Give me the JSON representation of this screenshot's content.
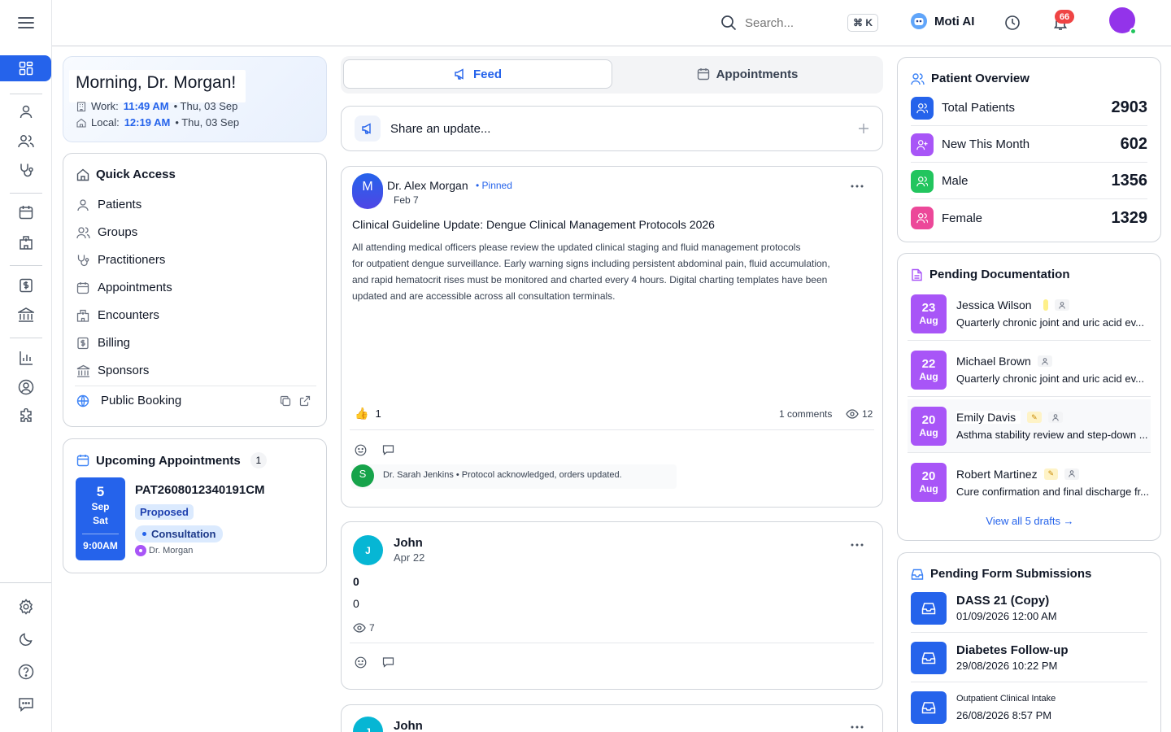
{
  "header": {
    "search_placeholder": "Search...",
    "shortcut": "⌘ K",
    "ai_label": "Moti AI",
    "notification_count": "66"
  },
  "greeting": {
    "title": "Morning, Dr. Morgan!",
    "work_label": "Work:",
    "work_time": "11:49 AM",
    "work_date": "• Thu, 03 Sep",
    "local_label": "Local:",
    "local_time": "12:19 AM",
    "local_date": "• Thu, 03 Sep"
  },
  "quick_access": {
    "title": "Quick Access",
    "items": [
      {
        "label": "Patients",
        "icon": "user-icon"
      },
      {
        "label": "Groups",
        "icon": "users-icon"
      },
      {
        "label": "Practitioners",
        "icon": "stethoscope-icon"
      },
      {
        "label": "Appointments",
        "icon": "calendar-icon"
      },
      {
        "label": "Encounters",
        "icon": "hospital-icon"
      },
      {
        "label": "Billing",
        "icon": "billing-icon"
      },
      {
        "label": "Sponsors",
        "icon": "bank-icon"
      }
    ],
    "public_booking": "Public Booking"
  },
  "upcoming": {
    "title": "Upcoming Appointments",
    "count": "1",
    "appointment": {
      "day": "5",
      "month": "Sep",
      "weekday": "Sat",
      "time": "9:00AM",
      "id": "PAT2608012340191CM",
      "status": "Proposed",
      "type": "Consultation",
      "practitioner": "Dr. Morgan"
    }
  },
  "tabs": {
    "feed": "Feed",
    "appointments": "Appointments"
  },
  "share": {
    "placeholder": "Share an update..."
  },
  "posts": [
    {
      "avatar": "M",
      "author": "Dr. Alex Morgan",
      "pinned": "• Pinned",
      "date": "Feb 7",
      "title": "Clinical Guideline Update: Dengue Clinical Management Protocols 2026",
      "body_lines": [
        "All attending medical officers please review the updated clinical staging and fluid management protocols",
        "for outpatient dengue surveillance. Early warning signs including persistent abdominal pain, fluid accumulation,",
        "and rapid hematocrit rises must be monitored and charted every 4 hours. Digital charting templates have been",
        "updated and are accessible across all consultation terminals."
      ],
      "likes": "1",
      "comments": "1 comments",
      "views": "12",
      "comment": {
        "avatar": "S",
        "text": "Dr. Sarah Jenkins • Protocol acknowledged, orders updated."
      }
    },
    {
      "avatar": "J",
      "author": "John",
      "date": "Apr 22",
      "title": "0",
      "body": "0",
      "views": "7"
    },
    {
      "avatar": "J",
      "author": "John"
    }
  ],
  "patient_overview": {
    "title": "Patient Overview",
    "rows": [
      {
        "label": "Total Patients",
        "value": "2903",
        "color": "#2563eb"
      },
      {
        "label": "New This Month",
        "value": "602",
        "color": "#a855f7"
      },
      {
        "label": "Male",
        "value": "1356",
        "color": "#22c55e"
      },
      {
        "label": "Female",
        "value": "1329",
        "color": "#ec4899"
      }
    ]
  },
  "pending_docs": {
    "title": "Pending Documentation",
    "items": [
      {
        "day": "23",
        "month": "Aug",
        "name": "Jessica Wilson",
        "desc": "Quarterly chronic joint and uric acid ev..."
      },
      {
        "day": "22",
        "month": "Aug",
        "name": "Michael Brown",
        "desc": "Quarterly chronic joint and uric acid ev..."
      },
      {
        "day": "20",
        "month": "Aug",
        "name": "Emily Davis",
        "desc": "Asthma stability review and step-down ..."
      },
      {
        "day": "20",
        "month": "Aug",
        "name": "Robert Martinez",
        "desc": "Cure confirmation and final discharge fr..."
      }
    ],
    "view_all": "View all 5 drafts →"
  },
  "pending_forms": {
    "title": "Pending Form Submissions",
    "items": [
      {
        "title": "DASS 21 (Copy)",
        "date": "01/09/2026 12:00 AM"
      },
      {
        "title": "Diabetes Follow-up",
        "date": "29/08/2026 10:22 PM"
      },
      {
        "title": "Outpatient Clinical Intake",
        "date": "26/08/2026 8:57 PM"
      }
    ]
  }
}
